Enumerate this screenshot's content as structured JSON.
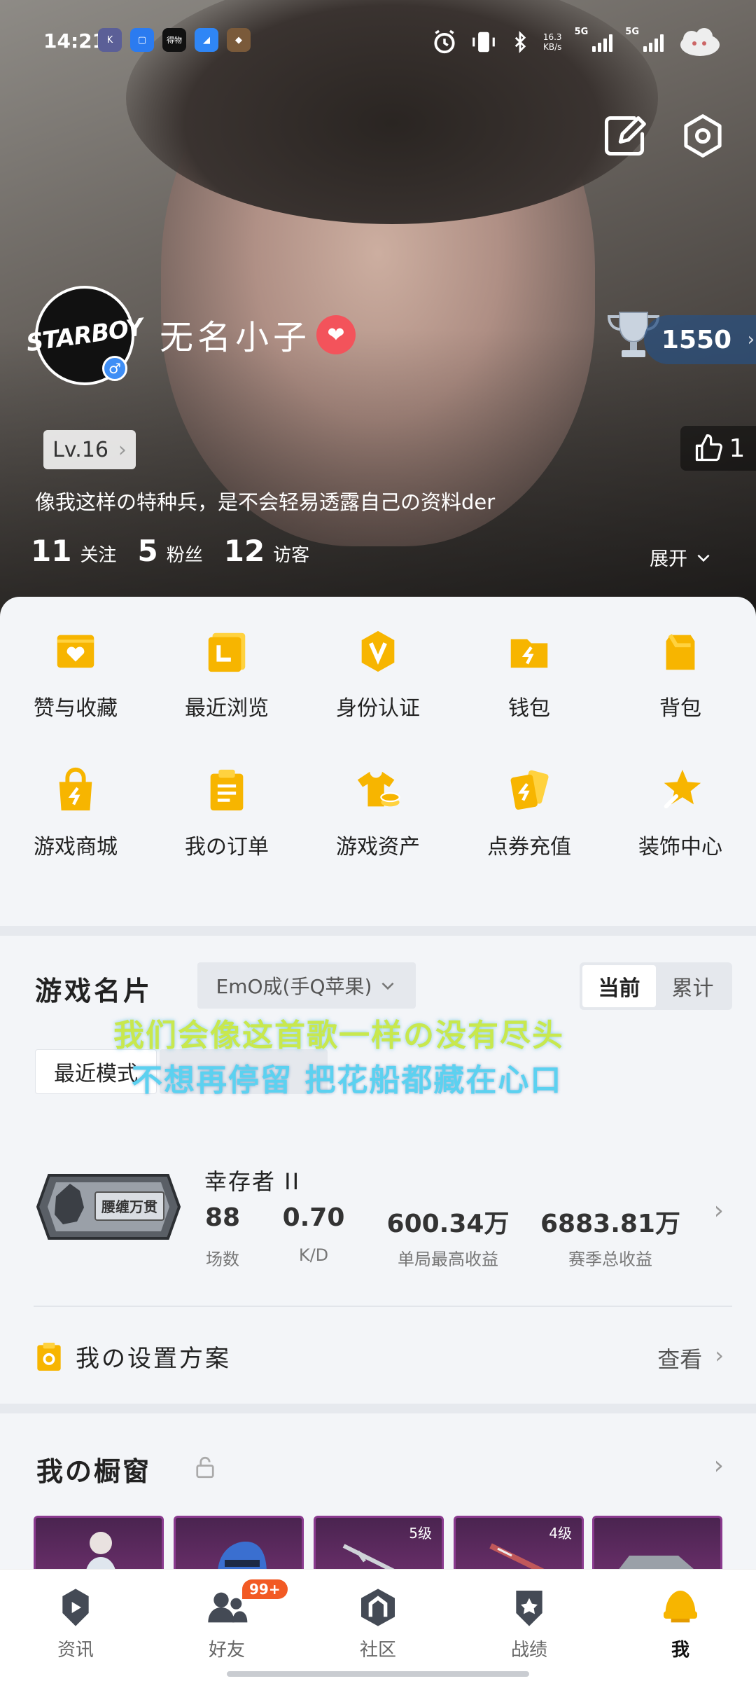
{
  "status": {
    "time": "14:21",
    "speed_value": "16.3",
    "speed_unit": "KB/s",
    "net1": "5G",
    "net2": "5G",
    "apps": [
      {
        "label": "K",
        "color": "#5b5f97"
      },
      {
        "label": "",
        "color": "#2b7bf0"
      },
      {
        "label": "得物",
        "color": "#111111"
      },
      {
        "label": "",
        "color": "#2f86f6"
      },
      {
        "label": "",
        "color": "#7a5a3a"
      }
    ]
  },
  "profile": {
    "username": "无名小子",
    "avatar_text": "STARBOY",
    "gender_symbol": "♂",
    "level": "Lv.16",
    "points": "1550",
    "likes": "1",
    "bio": "像我这样の特种兵，是不会轻易透露自己の资料der",
    "follow_count": "11",
    "follow_label": "关注",
    "fans_count": "5",
    "fans_label": "粉丝",
    "visitor_count": "12",
    "visitor_label": "访客",
    "expand_label": "展开"
  },
  "features": [
    {
      "label": "赞与收藏",
      "icon": "heart-folder-icon"
    },
    {
      "label": "最近浏览",
      "icon": "history-icon"
    },
    {
      "label": "身份认证",
      "icon": "verify-badge-icon"
    },
    {
      "label": "钱包",
      "icon": "wallet-icon"
    },
    {
      "label": "背包",
      "icon": "backpack-icon"
    },
    {
      "label": "游戏商城",
      "icon": "shopping-bag-icon"
    },
    {
      "label": "我の订单",
      "icon": "order-list-icon"
    },
    {
      "label": "游戏资产",
      "icon": "tshirt-coins-icon"
    },
    {
      "label": "点券充值",
      "icon": "voucher-cards-icon"
    },
    {
      "label": "装饰中心",
      "icon": "star-brush-icon"
    }
  ],
  "game_card": {
    "title": "游戏名片",
    "account": "EmO成(手Q苹果)",
    "toggle": [
      "当前",
      "累计"
    ],
    "overlay_line1": "我们会像这首歌一样の没有尽头",
    "overlay_line2": "不想再停留 把花船都藏在心口",
    "mode": "最近模式",
    "season_badge": "腰缠万贯",
    "season_name": "幸存者 II",
    "stats": [
      {
        "value": "88",
        "label": "场数"
      },
      {
        "value": "0.70",
        "label": "K/D"
      },
      {
        "value": "600.34万",
        "label": "单局最高收益"
      },
      {
        "value": "6883.81万",
        "label": "赛季总收益"
      }
    ],
    "plan_label": "我の设置方案",
    "view_label": "查看"
  },
  "showcase": {
    "title": "我の橱窗",
    "slots": [
      {
        "level": ""
      },
      {
        "level": ""
      },
      {
        "level": "5级"
      },
      {
        "level": "4级"
      },
      {
        "level": ""
      }
    ]
  },
  "nav": {
    "tabs": [
      {
        "label": "资讯",
        "icon": "news-play-icon"
      },
      {
        "label": "好友",
        "icon": "friends-icon"
      },
      {
        "label": "社区",
        "icon": "community-icon"
      },
      {
        "label": "战绩",
        "icon": "record-shield-icon"
      },
      {
        "label": "我",
        "icon": "helmet-icon"
      }
    ],
    "friends_badge": "99+"
  },
  "colors": {
    "accent": "#f7b500",
    "accent_light": "#ffd23f",
    "brand_blue": "#3f8ef5",
    "heart": "#f3535b"
  }
}
